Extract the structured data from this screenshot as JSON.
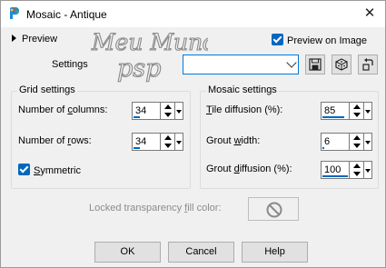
{
  "window": {
    "title": "Mosaic - Antique",
    "close_glyph": "✕"
  },
  "header": {
    "preview_label": "Preview",
    "preview_on_image_label": "Preview on Image",
    "preview_on_image_checked": true,
    "watermark_line1": "Meu Mundo",
    "watermark_line2": "psp"
  },
  "settings": {
    "label": "Settings",
    "value": "",
    "icons": [
      "save-preset-icon",
      "randomize-dice-icon",
      "reset-icon"
    ]
  },
  "grid_settings": {
    "title": "Grid settings",
    "columns_label_pre": "Number of ",
    "columns_label_u": "c",
    "columns_label_post": "olumns:",
    "columns_value": "34",
    "columns_fraction": 0.25,
    "rows_label_pre": "Number of ",
    "rows_label_u": "r",
    "rows_label_post": "ows:",
    "rows_value": "34",
    "rows_fraction": 0.25,
    "symmetric_pre": "",
    "symmetric_u": "S",
    "symmetric_post": "ymmetric",
    "symmetric_checked": true
  },
  "mosaic_settings": {
    "title": "Mosaic settings",
    "tile_label_pre": "",
    "tile_label_u": "T",
    "tile_label_post": "ile diffusion (%):",
    "tile_value": "85",
    "tile_fraction": 0.85,
    "grout_label_pre": "Grout ",
    "grout_label_u": "w",
    "grout_label_post": "idth:",
    "grout_value": "6",
    "grout_fraction": 0.06,
    "grout_diff_label_pre": "Grout ",
    "grout_diff_label_u": "d",
    "grout_diff_label_post": "iffusion (%):",
    "grout_diff_value": "100",
    "grout_diff_fraction": 1.0
  },
  "locked": {
    "label_pre": "Locked transparency ",
    "label_u": "f",
    "label_post": "ill color:",
    "swatch_icon": "no-color-icon"
  },
  "buttons": {
    "ok": "OK",
    "cancel": "Cancel",
    "help": "Help"
  },
  "colors": {
    "accent": "#0067c0",
    "focus": "#0078d7",
    "disabled_text": "#8c8c8c"
  }
}
